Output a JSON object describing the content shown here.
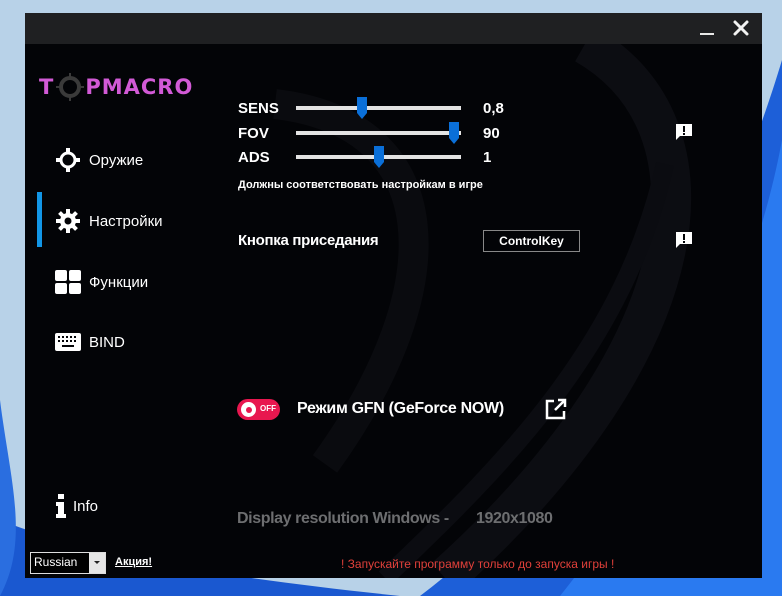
{
  "window": {
    "controls": {
      "minimize_label": "Minimize",
      "close_label": "Close"
    }
  },
  "logo": {
    "prefix": "T",
    "suffix": "PMACRO",
    "color": "#d25ad6"
  },
  "sidebar": {
    "active_index": 1,
    "accent_color": "#1296e6",
    "items": [
      {
        "label": "Оружие",
        "icon": "crosshair-icon"
      },
      {
        "label": "Настройки",
        "icon": "gear-icon"
      },
      {
        "label": "Функции",
        "icon": "grid-icon"
      },
      {
        "label": "BIND",
        "icon": "keyboard-icon"
      }
    ],
    "info": {
      "label": "Info",
      "icon": "info-icon"
    },
    "language": {
      "selected": "Russian"
    },
    "promo_link": "Акция!"
  },
  "settings": {
    "sliders": [
      {
        "label": "SENS",
        "value": "0,8",
        "position_percent": 40
      },
      {
        "label": "FOV",
        "value": "90",
        "position_percent": 96
      },
      {
        "label": "ADS",
        "value": "1",
        "position_percent": 50
      }
    ],
    "sliders_hint": "Должны соответствовать настройкам в игре",
    "crouch": {
      "label": "Кнопка приседания",
      "key": "ControlKey"
    },
    "gfn": {
      "label": "Режим GFN (GeForce NOW)",
      "toggle_state": "OFF",
      "enabled": false,
      "toggle_color": "#e8174f"
    },
    "resolution": {
      "label": "Display resolution Windows -",
      "value": "1920x1080"
    }
  },
  "footer": {
    "warning": "! Запускайте программу только до запуска игры !",
    "warning_color": "#e0403a"
  }
}
